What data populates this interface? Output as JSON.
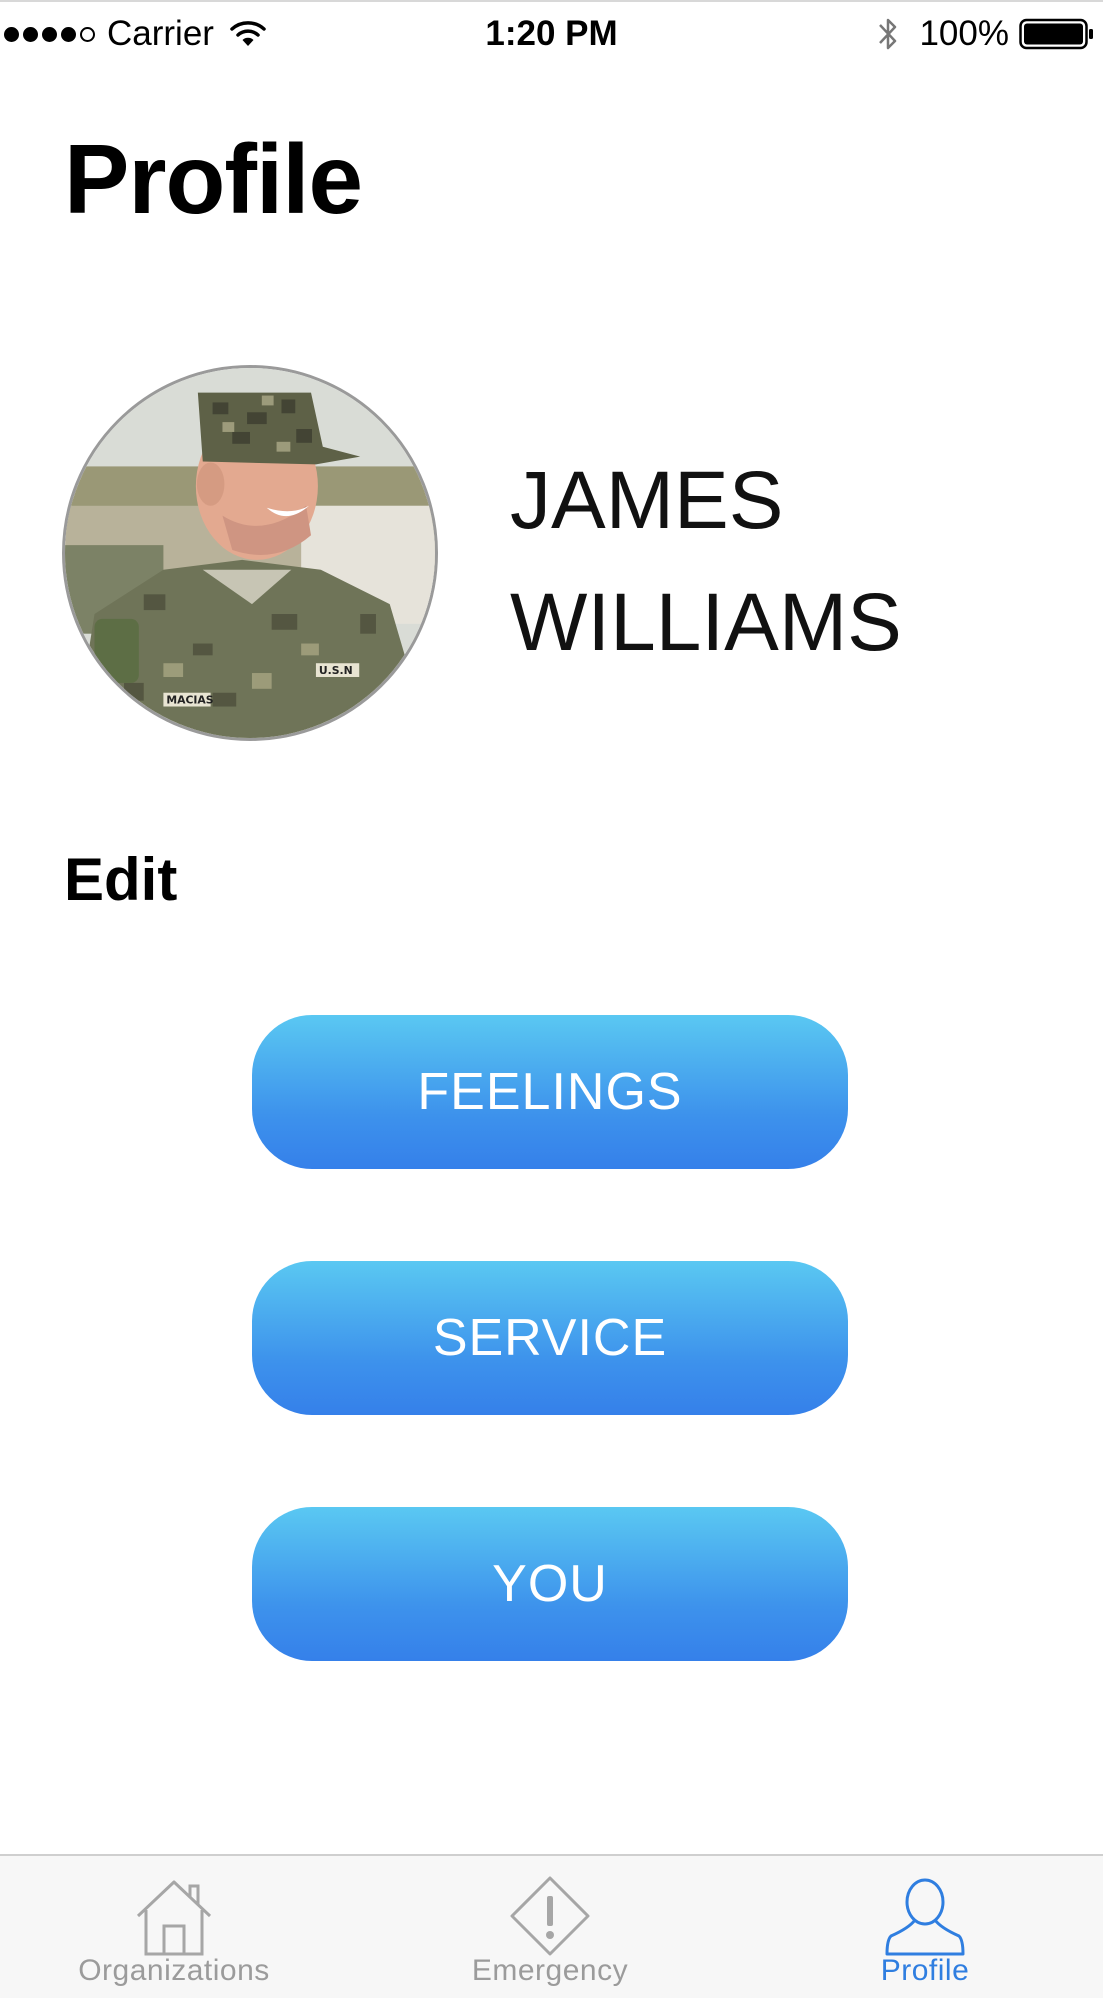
{
  "status_bar": {
    "signal": "●●●●○",
    "carrier": "Carrier",
    "time": "1:20 PM",
    "battery": "100%"
  },
  "page": {
    "title": "Profile"
  },
  "profile": {
    "name": "JAMES\nWILLIAMS",
    "edit_label": "Edit"
  },
  "buttons": {
    "feelings": "FEELINGS",
    "service": "SERVICE",
    "you": "YOU"
  },
  "tabs": [
    {
      "label": "Organizations",
      "icon": "house-icon",
      "active": false
    },
    {
      "label": "Emergency",
      "icon": "warning-diamond-icon",
      "active": false
    },
    {
      "label": "Profile",
      "icon": "person-icon",
      "active": true
    }
  ],
  "colors": {
    "button_top": "#5ac8f2",
    "button_bottom": "#3580ea",
    "tab_active": "#2f7ee0",
    "tab_inactive": "#9b9b9b"
  }
}
